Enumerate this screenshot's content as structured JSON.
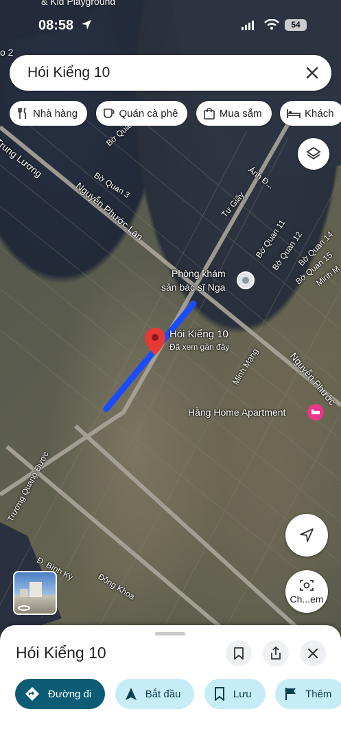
{
  "status_bar": {
    "time": "08:58",
    "battery": "54",
    "top_fragment": "& Kid Playground"
  },
  "search": {
    "query": "Hói Kiểng 10"
  },
  "chips": [
    {
      "icon": "fork-knife-icon",
      "label": "Nhà hàng"
    },
    {
      "icon": "coffee-cup-icon",
      "label": "Quán cà phê"
    },
    {
      "icon": "shopping-bag-icon",
      "label": "Mua sắm"
    },
    {
      "icon": "bed-icon",
      "label": "Khách"
    }
  ],
  "map": {
    "left_edge_fragment": "o 2",
    "streets": {
      "trung_luong": "Trung Lương",
      "nguyen_phuoc_lan": "Nguyễn Phước Lan",
      "bo_quan": "Bờ Quan",
      "bo_quan_3": "Bờ Quan 3",
      "anh_d": "Ánh Đ...",
      "tu_giay": "Tư Giấy",
      "bo_quan_11": "Bờ Quan 11",
      "bo_quan_12": "Bờ Quan 12",
      "bo_quan_14": "Bờ Quan 14",
      "bo_quan_15": "Bờ Quan 15",
      "minh_right": "Minh M",
      "minh_mang": "Minh Mạng",
      "nguyen_phuoc_right": "Nguyễn Phước",
      "truong_quang_duoc": "Trương Quang Được",
      "d_binh_ky": "Đ. Bình Kỳ",
      "dong_khoa": "Đồng Khoa"
    },
    "poi_clinic_line1": "Phòng khám",
    "poi_clinic_line2": "sản bác sĩ Nga",
    "poi_hotel": "Hằng Home Apartment",
    "pin_title": "Hói Kiểng 10",
    "pin_subtitle": "Đã xem gần đây",
    "route_color": "#1a4cff",
    "pin_color": "#e53935",
    "hotel_color": "#e8378a"
  },
  "controls": {
    "lens_label": "Ch...em"
  },
  "sheet": {
    "title": "Hói Kiểng 10",
    "actions": [
      {
        "icon": "directions-icon",
        "label": "Đường đi",
        "style": "primary"
      },
      {
        "icon": "navigation-arrow-icon",
        "label": "Bắt đầu",
        "style": "secondary"
      },
      {
        "icon": "bookmark-icon",
        "label": "Lưu",
        "style": "secondary"
      },
      {
        "icon": "flag-icon",
        "label": "Thêm",
        "style": "secondary"
      }
    ]
  },
  "colors": {
    "primary_button": "#0b5c74",
    "secondary_button": "#c6ecf7"
  }
}
